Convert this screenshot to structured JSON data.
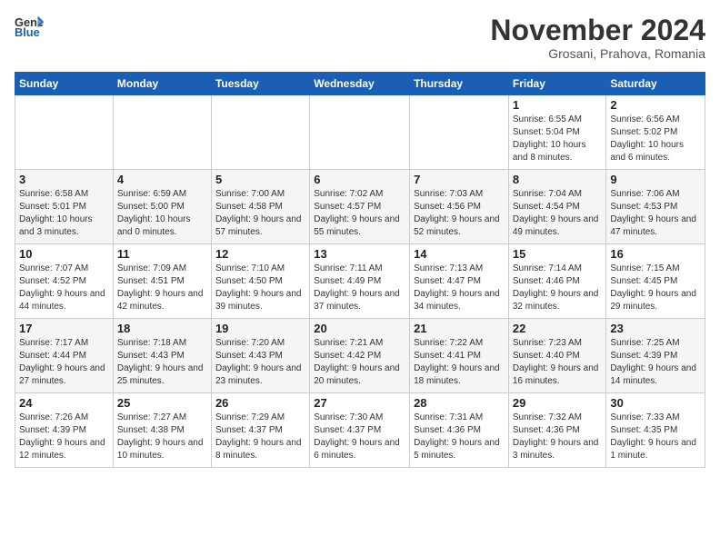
{
  "logo": {
    "line1": "General",
    "line2": "Blue"
  },
  "title": "November 2024",
  "location": "Grosani, Prahova, Romania",
  "days_of_week": [
    "Sunday",
    "Monday",
    "Tuesday",
    "Wednesday",
    "Thursday",
    "Friday",
    "Saturday"
  ],
  "weeks": [
    [
      {
        "day": "",
        "info": ""
      },
      {
        "day": "",
        "info": ""
      },
      {
        "day": "",
        "info": ""
      },
      {
        "day": "",
        "info": ""
      },
      {
        "day": "",
        "info": ""
      },
      {
        "day": "1",
        "info": "Sunrise: 6:55 AM\nSunset: 5:04 PM\nDaylight: 10 hours and 8 minutes."
      },
      {
        "day": "2",
        "info": "Sunrise: 6:56 AM\nSunset: 5:02 PM\nDaylight: 10 hours and 6 minutes."
      }
    ],
    [
      {
        "day": "3",
        "info": "Sunrise: 6:58 AM\nSunset: 5:01 PM\nDaylight: 10 hours and 3 minutes."
      },
      {
        "day": "4",
        "info": "Sunrise: 6:59 AM\nSunset: 5:00 PM\nDaylight: 10 hours and 0 minutes."
      },
      {
        "day": "5",
        "info": "Sunrise: 7:00 AM\nSunset: 4:58 PM\nDaylight: 9 hours and 57 minutes."
      },
      {
        "day": "6",
        "info": "Sunrise: 7:02 AM\nSunset: 4:57 PM\nDaylight: 9 hours and 55 minutes."
      },
      {
        "day": "7",
        "info": "Sunrise: 7:03 AM\nSunset: 4:56 PM\nDaylight: 9 hours and 52 minutes."
      },
      {
        "day": "8",
        "info": "Sunrise: 7:04 AM\nSunset: 4:54 PM\nDaylight: 9 hours and 49 minutes."
      },
      {
        "day": "9",
        "info": "Sunrise: 7:06 AM\nSunset: 4:53 PM\nDaylight: 9 hours and 47 minutes."
      }
    ],
    [
      {
        "day": "10",
        "info": "Sunrise: 7:07 AM\nSunset: 4:52 PM\nDaylight: 9 hours and 44 minutes."
      },
      {
        "day": "11",
        "info": "Sunrise: 7:09 AM\nSunset: 4:51 PM\nDaylight: 9 hours and 42 minutes."
      },
      {
        "day": "12",
        "info": "Sunrise: 7:10 AM\nSunset: 4:50 PM\nDaylight: 9 hours and 39 minutes."
      },
      {
        "day": "13",
        "info": "Sunrise: 7:11 AM\nSunset: 4:49 PM\nDaylight: 9 hours and 37 minutes."
      },
      {
        "day": "14",
        "info": "Sunrise: 7:13 AM\nSunset: 4:47 PM\nDaylight: 9 hours and 34 minutes."
      },
      {
        "day": "15",
        "info": "Sunrise: 7:14 AM\nSunset: 4:46 PM\nDaylight: 9 hours and 32 minutes."
      },
      {
        "day": "16",
        "info": "Sunrise: 7:15 AM\nSunset: 4:45 PM\nDaylight: 9 hours and 29 minutes."
      }
    ],
    [
      {
        "day": "17",
        "info": "Sunrise: 7:17 AM\nSunset: 4:44 PM\nDaylight: 9 hours and 27 minutes."
      },
      {
        "day": "18",
        "info": "Sunrise: 7:18 AM\nSunset: 4:43 PM\nDaylight: 9 hours and 25 minutes."
      },
      {
        "day": "19",
        "info": "Sunrise: 7:20 AM\nSunset: 4:43 PM\nDaylight: 9 hours and 23 minutes."
      },
      {
        "day": "20",
        "info": "Sunrise: 7:21 AM\nSunset: 4:42 PM\nDaylight: 9 hours and 20 minutes."
      },
      {
        "day": "21",
        "info": "Sunrise: 7:22 AM\nSunset: 4:41 PM\nDaylight: 9 hours and 18 minutes."
      },
      {
        "day": "22",
        "info": "Sunrise: 7:23 AM\nSunset: 4:40 PM\nDaylight: 9 hours and 16 minutes."
      },
      {
        "day": "23",
        "info": "Sunrise: 7:25 AM\nSunset: 4:39 PM\nDaylight: 9 hours and 14 minutes."
      }
    ],
    [
      {
        "day": "24",
        "info": "Sunrise: 7:26 AM\nSunset: 4:39 PM\nDaylight: 9 hours and 12 minutes."
      },
      {
        "day": "25",
        "info": "Sunrise: 7:27 AM\nSunset: 4:38 PM\nDaylight: 9 hours and 10 minutes."
      },
      {
        "day": "26",
        "info": "Sunrise: 7:29 AM\nSunset: 4:37 PM\nDaylight: 9 hours and 8 minutes."
      },
      {
        "day": "27",
        "info": "Sunrise: 7:30 AM\nSunset: 4:37 PM\nDaylight: 9 hours and 6 minutes."
      },
      {
        "day": "28",
        "info": "Sunrise: 7:31 AM\nSunset: 4:36 PM\nDaylight: 9 hours and 5 minutes."
      },
      {
        "day": "29",
        "info": "Sunrise: 7:32 AM\nSunset: 4:36 PM\nDaylight: 9 hours and 3 minutes."
      },
      {
        "day": "30",
        "info": "Sunrise: 7:33 AM\nSunset: 4:35 PM\nDaylight: 9 hours and 1 minute."
      }
    ]
  ]
}
